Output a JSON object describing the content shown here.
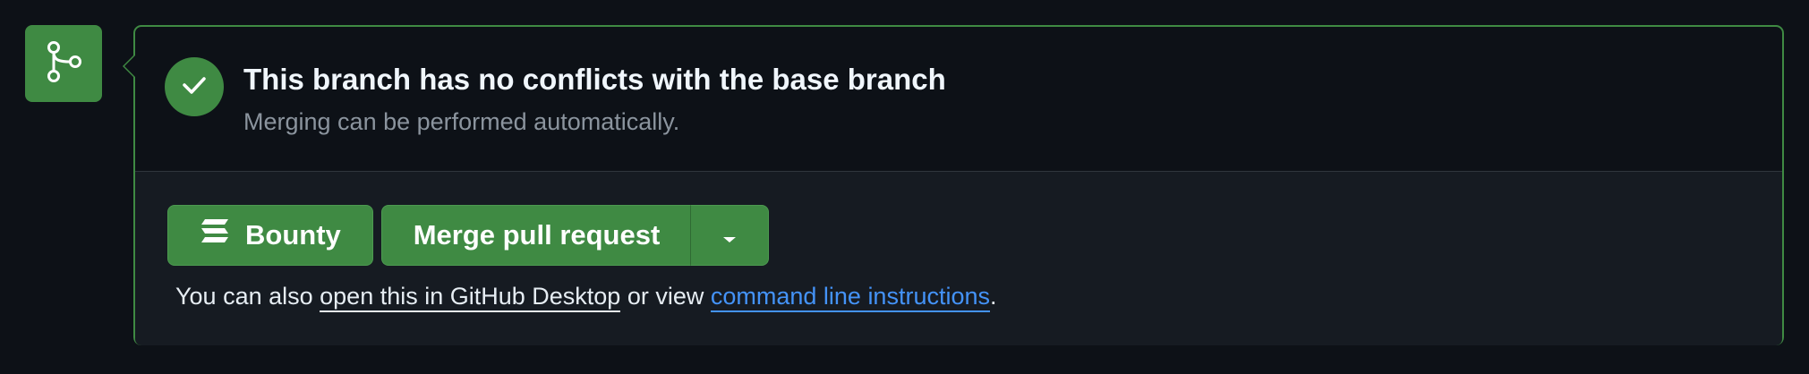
{
  "icons": {
    "branch_badge": "git-merge-icon",
    "status": "check-icon",
    "bounty": "bounty-icon",
    "dropdown": "triangle-down-icon"
  },
  "colors": {
    "success": "#3f8a43",
    "link": "#4493f8",
    "background": "#0d1117"
  },
  "status": {
    "title": "This branch has no conflicts with the base branch",
    "subtitle": "Merging can be performed automatically."
  },
  "actions": {
    "bounty_label": "Bounty",
    "merge_label": "Merge pull request"
  },
  "helper": {
    "prefix": "You can also ",
    "desktop_link": "open this in GitHub Desktop",
    "middle": " or view ",
    "cli_link": "command line instructions",
    "suffix": "."
  }
}
